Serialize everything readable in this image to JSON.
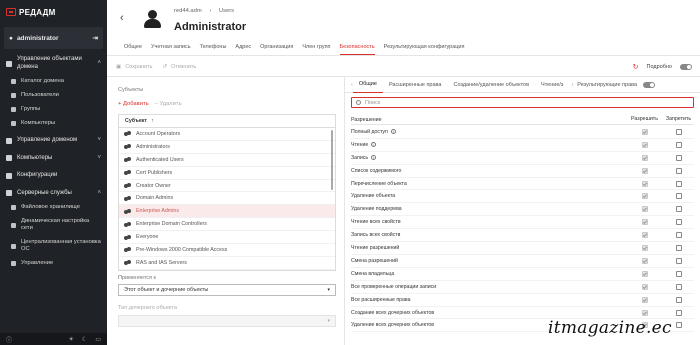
{
  "app": {
    "logo": "РЕДАДМ"
  },
  "user": {
    "name": "administrator"
  },
  "sidebar": {
    "items": [
      {
        "label": "Управление объектами домена",
        "expanded": true
      },
      {
        "label": "Каталог домена",
        "sub": true
      },
      {
        "label": "Пользователи",
        "sub": true
      },
      {
        "label": "Группы",
        "sub": true
      },
      {
        "label": "Компьютеры",
        "sub": true
      },
      {
        "label": "Управление доменом"
      },
      {
        "label": "Компьютеры"
      },
      {
        "label": "Конфигурации"
      },
      {
        "label": "Серверные службы",
        "expanded": true
      },
      {
        "label": "Файловое хранилище",
        "sub": true
      },
      {
        "label": "Динамическая настройка сети",
        "sub": true
      },
      {
        "label": "Централизованная установка ОС",
        "sub": true
      },
      {
        "label": "Управление",
        "sub": true
      }
    ]
  },
  "header": {
    "breadcrumb": [
      "red44.adm",
      "Users"
    ],
    "title": "Administrator",
    "tabs": [
      "Общее",
      "Учетная запись",
      "Телефоны",
      "Адрес",
      "Организация",
      "Член групп",
      "Безопасность",
      "Результирующая конфигурация"
    ],
    "active_tab": 6
  },
  "toolbar": {
    "save": "Сохранить",
    "cancel": "Отменить",
    "detailed": "Подробно"
  },
  "left": {
    "subjects_label": "Субъекты",
    "add": "Добавить",
    "remove": "Удалить",
    "column": "Субъект",
    "subjects": [
      "Account Operators",
      "Administrators",
      "Authenticated Users",
      "Cert Publishers",
      "Creator Owner",
      "Domain Admins",
      "Enterprise Admins",
      "Enterprise Domain Controllers",
      "Everyone",
      "Pre-Windows 2000 Compatible Access",
      "RAS and IAS Servers"
    ],
    "selected_index": 6,
    "apply_label": "Применяется к",
    "apply_value": "Этот объект и дочерние объекты",
    "child_type_label": "Тип дочернего объекта"
  },
  "right": {
    "tabs": [
      "Общие",
      "Расширенные права",
      "Создание/удаление объектов",
      "Чтение/з"
    ],
    "active_tab": 0,
    "result_label": "Результирующие права",
    "search_placeholder": "Поиск",
    "col_perm": "Разрешение",
    "col_allow": "Разрешить",
    "col_deny": "Запретить",
    "permissions": [
      {
        "name": "Полный доступ",
        "info": true
      },
      {
        "name": "Чтение",
        "info": true
      },
      {
        "name": "Запись",
        "info": true
      },
      {
        "name": "Список содержимого"
      },
      {
        "name": "Перечисление объекта"
      },
      {
        "name": "Удаление объекта"
      },
      {
        "name": "Удаление поддерева"
      },
      {
        "name": "Чтение всех свойств"
      },
      {
        "name": "Запись всех свойств"
      },
      {
        "name": "Чтение разрешений"
      },
      {
        "name": "Смена разрешений"
      },
      {
        "name": "Смена владельца"
      },
      {
        "name": "Все проверенные операции записи"
      },
      {
        "name": "Все расширенные права"
      },
      {
        "name": "Создание всех дочерних объектов"
      },
      {
        "name": "Удаление всех дочерних объектов"
      }
    ]
  },
  "watermark": "itmagazine.ec"
}
